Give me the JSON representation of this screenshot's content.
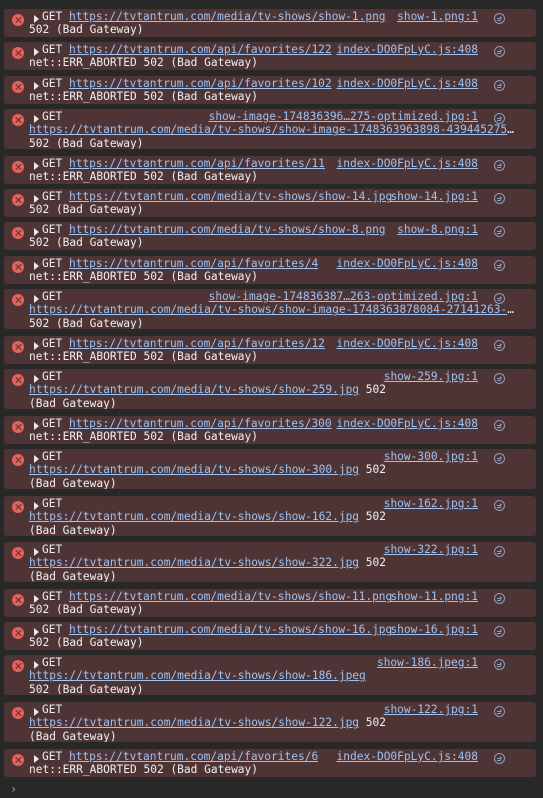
{
  "console": {
    "prompt_symbol": "›",
    "entries": [
      {
        "method": "GET",
        "url": "https://tvtantrum.com/media/tv-shows/show-1.png",
        "source": "show-1.png:1",
        "status": "502 (Bad Gateway)"
      },
      {
        "method": "GET",
        "url": "https://tvtantrum.com/api/favorites/122",
        "source": "index-DO0FpLyC.js:408",
        "status": "net::ERR_ABORTED 502 (Bad Gateway)"
      },
      {
        "method": "GET",
        "url": "https://tvtantrum.com/api/favorites/102",
        "source": "index-DO0FpLyC.js:408",
        "status": "net::ERR_ABORTED 502 (Bad Gateway)"
      },
      {
        "method": "GET",
        "url": "https://tvtantrum.com/media/tv-shows/show-image-1748363963898-439445275-optimized.jpg",
        "url_display": "https://tvtantrum.com/media/tv-shows/show-image-1748363963898-439445275-…",
        "source": "show-image-174836396…275-optimized.jpg:1",
        "status": "502 (Bad Gateway)"
      },
      {
        "method": "GET",
        "url": "https://tvtantrum.com/api/favorites/11",
        "source": "index-DO0FpLyC.js:408",
        "status": "net::ERR_ABORTED 502 (Bad Gateway)"
      },
      {
        "method": "GET",
        "url": "https://tvtantrum.com/media/tv-shows/show-14.jpg",
        "source": "show-14.jpg:1",
        "status": "502 (Bad Gateway)"
      },
      {
        "method": "GET",
        "url": "https://tvtantrum.com/media/tv-shows/show-8.png",
        "source": "show-8.png:1",
        "status": "502 (Bad Gateway)"
      },
      {
        "method": "GET",
        "url": "https://tvtantrum.com/api/favorites/4",
        "source": "index-DO0FpLyC.js:408",
        "status": "net::ERR_ABORTED 502 (Bad Gateway)"
      },
      {
        "method": "GET",
        "url": "https://tvtantrum.com/media/tv-shows/show-image-1748363878084-27141263-optimized.jpg",
        "url_display": "https://tvtantrum.com/media/tv-shows/show-image-1748363878084-27141263-o…",
        "source": "show-image-174836387…263-optimized.jpg:1",
        "status": "502 (Bad Gateway)"
      },
      {
        "method": "GET",
        "url": "https://tvtantrum.com/api/favorites/12",
        "source": "index-DO0FpLyC.js:408",
        "status": "net::ERR_ABORTED 502 (Bad Gateway)"
      },
      {
        "method": "GET",
        "url": "https://tvtantrum.com/media/tv-shows/show-259.jpg",
        "source": "show-259.jpg:1",
        "status": "502 (Bad Gateway)"
      },
      {
        "method": "GET",
        "url": "https://tvtantrum.com/api/favorites/300",
        "source": "index-DO0FpLyC.js:408",
        "status": "net::ERR_ABORTED 502 (Bad Gateway)"
      },
      {
        "method": "GET",
        "url": "https://tvtantrum.com/media/tv-shows/show-300.jpg",
        "source": "show-300.jpg:1",
        "status": "502 (Bad Gateway)"
      },
      {
        "method": "GET",
        "url": "https://tvtantrum.com/media/tv-shows/show-162.jpg",
        "source": "show-162.jpg:1",
        "status": "502 (Bad Gateway)"
      },
      {
        "method": "GET",
        "url": "https://tvtantrum.com/media/tv-shows/show-322.jpg",
        "source": "show-322.jpg:1",
        "status": "502 (Bad Gateway)"
      },
      {
        "method": "GET",
        "url": "https://tvtantrum.com/media/tv-shows/show-11.png",
        "source": "show-11.png:1",
        "status": "502 (Bad Gateway)"
      },
      {
        "method": "GET",
        "url": "https://tvtantrum.com/media/tv-shows/show-16.jpg",
        "source": "show-16.jpg:1",
        "status": "502 (Bad Gateway)"
      },
      {
        "method": "GET",
        "url": "https://tvtantrum.com/media/tv-shows/show-186.jpeg",
        "source": "show-186.jpeg:1",
        "status": "502 (Bad Gateway)"
      },
      {
        "method": "GET",
        "url": "https://tvtantrum.com/media/tv-shows/show-122.jpg",
        "source": "show-122.jpg:1",
        "status": "502 (Bad Gateway)"
      },
      {
        "method": "GET",
        "url": "https://tvtantrum.com/api/favorites/6",
        "source": "index-DO0FpLyC.js:408",
        "status": "net::ERR_ABORTED 502 (Bad Gateway)"
      }
    ]
  },
  "colors": {
    "background": "#282828",
    "error_row_bg": "#4e3434",
    "error_icon": "#e8615c",
    "link": "#9fc3f5"
  }
}
